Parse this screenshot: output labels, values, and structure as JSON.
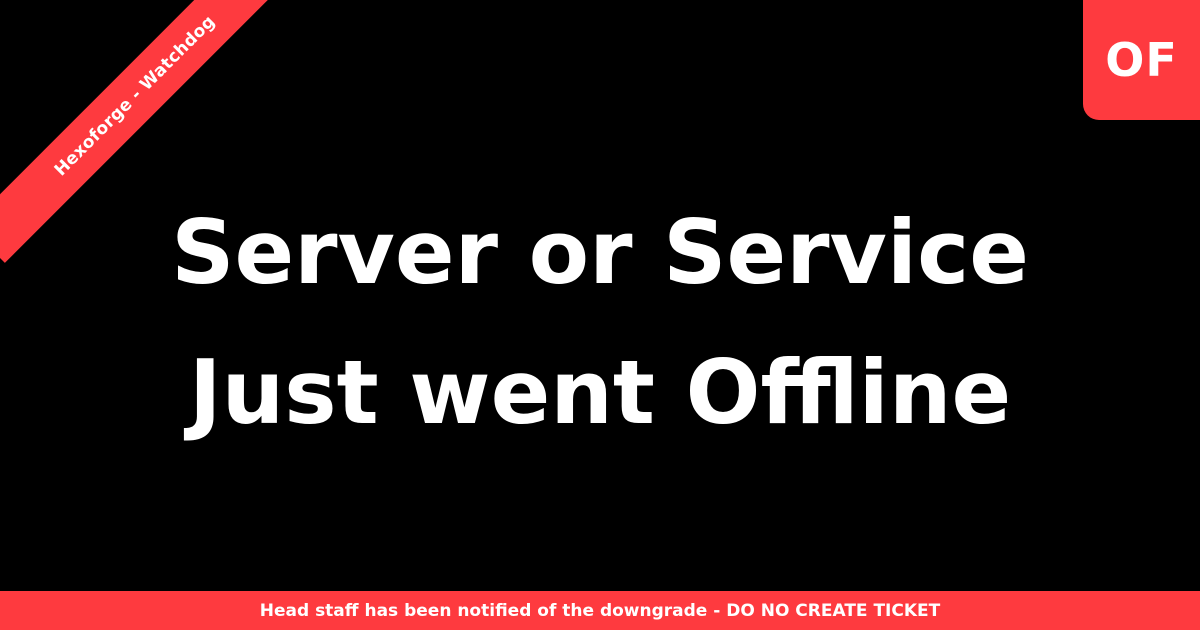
{
  "ribbon": {
    "label": "Hexoforge - Watchdog"
  },
  "badge": {
    "label": "OF"
  },
  "headline": {
    "line1": "Server or Service",
    "line2": "Just went Offline"
  },
  "footer": {
    "notice": "Head staff has been notified of the downgrade - DO NO CREATE TICKET"
  },
  "colors": {
    "background": "#000000",
    "accent": "#fe3a3f",
    "text": "#ffffff"
  }
}
